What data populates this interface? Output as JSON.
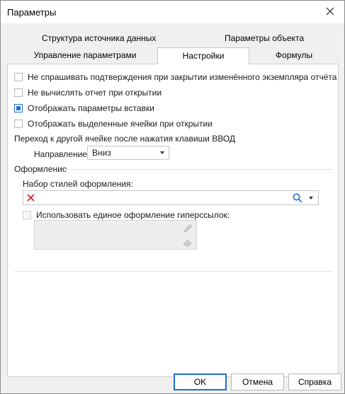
{
  "window": {
    "title": "Параметры"
  },
  "tabs": {
    "row1": [
      "Структура источника данных",
      "Параметры объекта"
    ],
    "row2": [
      "Управление параметрами",
      "Настройки",
      "Формулы"
    ]
  },
  "options": {
    "no_confirm_close": {
      "label": "Не спрашивать подтверждения при закрытии изменённого экземпляра отчёта",
      "checked": false
    },
    "no_calc_on_open": {
      "label": "Не вычислять отчет при открытии",
      "checked": false
    },
    "show_insert_params": {
      "label": "Отображать параметры вставки",
      "checked": true
    },
    "show_selected_cells": {
      "label": "Отображать выделенные ячейки при открытии",
      "checked": false
    }
  },
  "enter_move": {
    "heading": "Переход к другой ячейке после нажатия клавиши ВВОД",
    "direction_label": "Направление:",
    "direction_value": "Вниз"
  },
  "design": {
    "heading": "Оформление",
    "style_set_label": "Набор стилей оформления:",
    "unified_hyperlinks_label": "Использовать единое оформление гиперссылок:",
    "unified_hyperlinks_checked": false
  },
  "buttons": {
    "ok": "OK",
    "cancel": "Отмена",
    "help": "Справка"
  },
  "colors": {
    "accent": "#1f6fd1",
    "clear_red": "#d62828"
  }
}
